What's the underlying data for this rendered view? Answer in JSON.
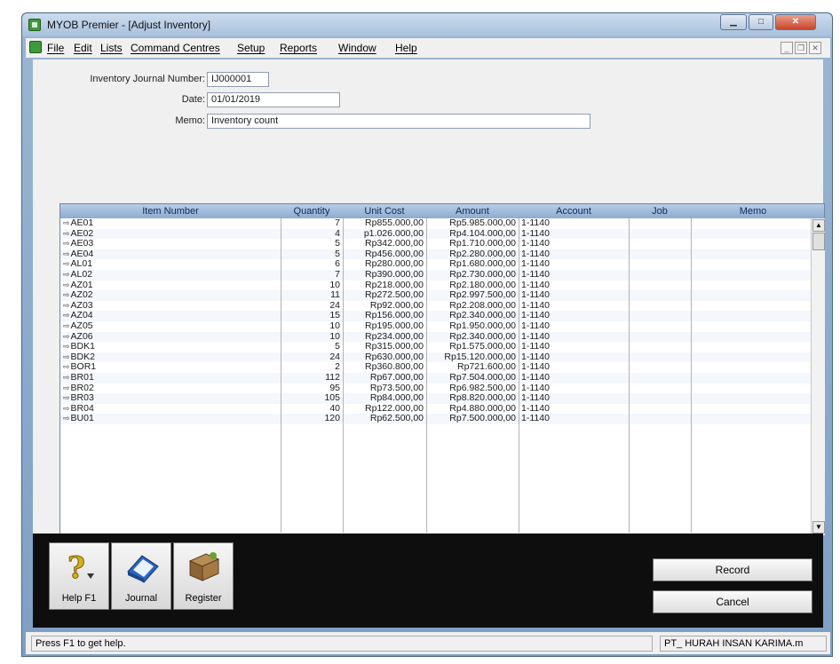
{
  "window": {
    "title": "MYOB Premier - [Adjust Inventory]"
  },
  "menu": [
    "File",
    "Edit",
    "Lists",
    "Command Centres",
    "Setup",
    "Reports",
    "Window",
    "Help"
  ],
  "form": {
    "journal_label": "Inventory Journal Number:",
    "journal_value": "IJ000001",
    "date_label": "Date:",
    "date_value": "01/01/2019",
    "memo_label": "Memo:",
    "memo_value": "Inventory count"
  },
  "grid": {
    "columns": [
      "Item Number",
      "Quantity",
      "Unit Cost",
      "Amount",
      "Account",
      "Job",
      "Memo"
    ],
    "rows": [
      [
        "AE01",
        "7",
        "Rp855.000,00",
        "Rp5.985.000,00",
        "1-1140"
      ],
      [
        "AE02",
        "4",
        "p1.026.000,00",
        "Rp4.104.000,00",
        "1-1140"
      ],
      [
        "AE03",
        "5",
        "Rp342.000,00",
        "Rp1.710.000,00",
        "1-1140"
      ],
      [
        "AE04",
        "5",
        "Rp456.000,00",
        "Rp2.280.000,00",
        "1-1140"
      ],
      [
        "AL01",
        "6",
        "Rp280.000,00",
        "Rp1.680.000,00",
        "1-1140"
      ],
      [
        "AL02",
        "7",
        "Rp390.000,00",
        "Rp2.730.000,00",
        "1-1140"
      ],
      [
        "AZ01",
        "10",
        "Rp218.000,00",
        "Rp2.180.000,00",
        "1-1140"
      ],
      [
        "AZ02",
        "11",
        "Rp272.500,00",
        "Rp2.997.500,00",
        "1-1140"
      ],
      [
        "AZ03",
        "24",
        "Rp92.000,00",
        "Rp2.208.000,00",
        "1-1140"
      ],
      [
        "AZ04",
        "15",
        "Rp156.000,00",
        "Rp2.340.000,00",
        "1-1140"
      ],
      [
        "AZ05",
        "10",
        "Rp195.000,00",
        "Rp1.950.000,00",
        "1-1140"
      ],
      [
        "AZ06",
        "10",
        "Rp234.000,00",
        "Rp2.340.000,00",
        "1-1140"
      ],
      [
        "BDK1",
        "5",
        "Rp315.000,00",
        "Rp1.575.000,00",
        "1-1140"
      ],
      [
        "BDK2",
        "24",
        "Rp630.000,00",
        "Rp15.120.000,00",
        "1-1140"
      ],
      [
        "BOR1",
        "2",
        "Rp360.800,00",
        "Rp721.600,00",
        "1-1140"
      ],
      [
        "BR01",
        "112",
        "Rp67.000,00",
        "Rp7.504.000,00",
        "1-1140"
      ],
      [
        "BR02",
        "95",
        "Rp73.500,00",
        "Rp6.982.500,00",
        "1-1140"
      ],
      [
        "BR03",
        "105",
        "Rp84.000,00",
        "Rp8.820.000,00",
        "1-1140"
      ],
      [
        "BR04",
        "40",
        "Rp122.000,00",
        "Rp4.880.000,00",
        "1-1140"
      ],
      [
        "BU01",
        "120",
        "Rp62.500,00",
        "Rp7.500.000,00",
        "1-1140"
      ]
    ]
  },
  "toolbar": {
    "help": "Help F1",
    "journal": "Journal",
    "register": "Register"
  },
  "actions": {
    "record": "Record",
    "cancel": "Cancel"
  },
  "status": {
    "left": "Press F1 to get help.",
    "right": "PT_ HURAH INSAN KARIMA.m"
  },
  "icons": [
    "app-icon",
    "help-icon",
    "journal-icon",
    "register-icon",
    "minimize-icon",
    "maximize-icon",
    "close-icon",
    "row-arrow-icon"
  ]
}
